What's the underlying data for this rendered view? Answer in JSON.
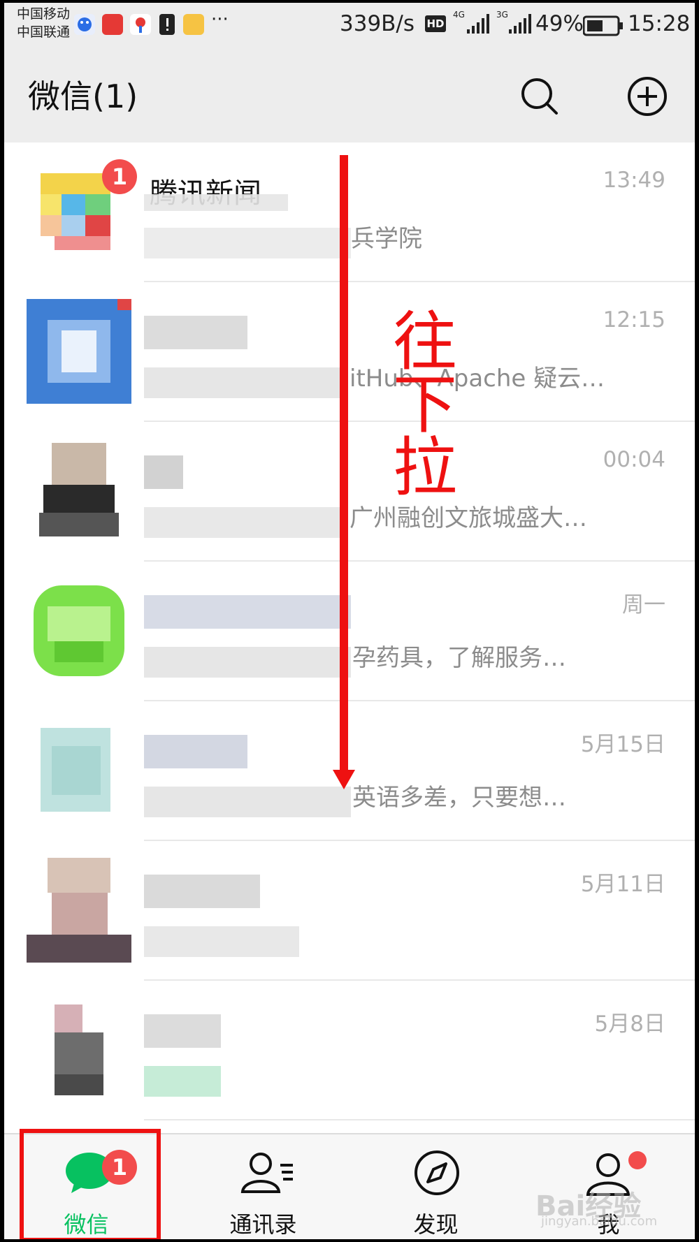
{
  "status_bar": {
    "carrier_1": "中国移动",
    "carrier_2": "中国联通",
    "more": "···",
    "net_speed": "339B/s",
    "hd": "HD",
    "net_4g": "4G",
    "net_3g": "3G",
    "battery": "49%",
    "time": "15:28"
  },
  "header": {
    "title": "微信(1)",
    "search_icon": "search-icon",
    "add_icon": "plus-circle-icon"
  },
  "chats": [
    {
      "name": "腾讯新闻",
      "time": "13:49",
      "message": "兵学院",
      "badge": "1"
    },
    {
      "name": "",
      "time": "12:15",
      "message": "itHub、Apache 疑云…"
    },
    {
      "name": "",
      "time": "00:04",
      "message": "广州融创文旅城盛大…"
    },
    {
      "name": "",
      "time": "周一",
      "message": "孕药具，了解服务…"
    },
    {
      "name": "",
      "time": "5月15日",
      "message": "英语多差，只要想…"
    },
    {
      "name": "",
      "time": "5月11日",
      "message": ""
    },
    {
      "name": "",
      "time": "5月8日",
      "message": ""
    }
  ],
  "annotation": {
    "chars": [
      "往",
      "下",
      "拉"
    ]
  },
  "tab_bar": {
    "tabs": [
      {
        "label": "微信",
        "icon": "chat-bubble-icon",
        "badge": "1",
        "active": true
      },
      {
        "label": "通讯录",
        "icon": "contacts-icon"
      },
      {
        "label": "发现",
        "icon": "compass-icon"
      },
      {
        "label": "我",
        "icon": "person-icon",
        "dot": true
      }
    ]
  },
  "watermark": {
    "main": "Bai经验",
    "sub": "jingyan.baidu.com"
  },
  "colors": {
    "wechat_green": "#07c160",
    "badge_red": "#f24c4c",
    "annotation_red": "#ee1111",
    "header_bg": "#ededed"
  }
}
